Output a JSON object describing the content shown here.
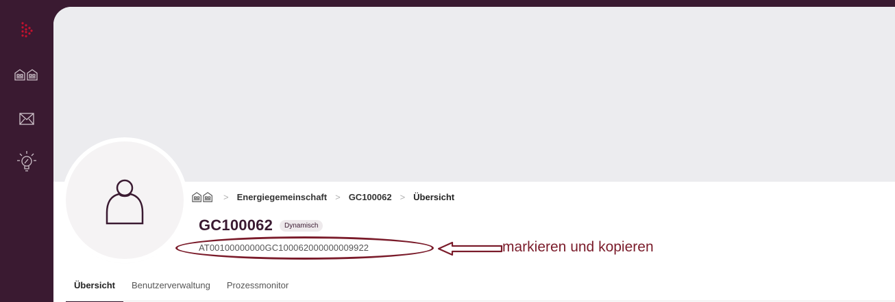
{
  "sidebar": {
    "items": [
      {
        "icon": "logo-icon"
      },
      {
        "icon": "buildings-icon"
      },
      {
        "icon": "mail-icon"
      },
      {
        "icon": "lightbulb-icon"
      }
    ]
  },
  "breadcrumb": {
    "home_icon": "buildings-icon",
    "items": [
      "Energiegemeinschaft",
      "GC100062",
      "Übersicht"
    ]
  },
  "header": {
    "title": "GC100062",
    "badge": "Dynamisch",
    "identifier": "AT00100000000GC100062000000009922"
  },
  "annotation": {
    "text": "markieren und kopieren",
    "color": "#7a1b2a"
  },
  "tabs": [
    {
      "label": "Übersicht",
      "active": true
    },
    {
      "label": "Benutzerverwaltung",
      "active": false
    },
    {
      "label": "Prozessmonitor",
      "active": false
    }
  ],
  "colors": {
    "sidebar": "#3a1a31",
    "banner": "#ececef",
    "accent": "#c8102e"
  }
}
